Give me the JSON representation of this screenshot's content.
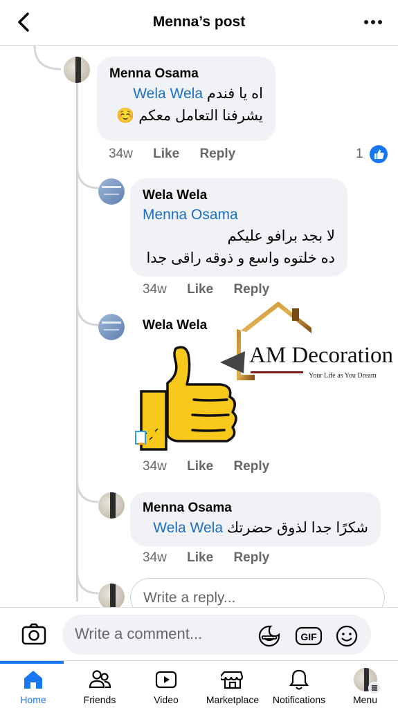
{
  "header": {
    "title": "Menna’s post"
  },
  "comments": [
    {
      "author": "Menna Osama",
      "mention": "Wela Wela",
      "line1": "اه يا فندم",
      "line2": "يشرفنا التعامل معكم",
      "emoji": "☺️",
      "time": "34w",
      "like": "Like",
      "reply": "Reply",
      "reaction_count": "1"
    },
    {
      "author": "Wela Wela",
      "mention": "Menna Osama",
      "line1": "لا بجد برافو عليكم",
      "line2": "ده خلتوه واسع و ذوقه راقى جدا",
      "time": "34w",
      "like": "Like",
      "reply": "Reply"
    },
    {
      "author": "Wela Wela",
      "sticker": "thumbs-up",
      "time": "34w",
      "like": "Like",
      "reply": "Reply"
    },
    {
      "author": "Menna Osama",
      "mention": "Wela Wela",
      "line1": "شكرًا جدا لذوق حضرتك",
      "time": "34w",
      "like": "Like",
      "reply": "Reply"
    }
  ],
  "reply_input": {
    "placeholder": "Write a reply..."
  },
  "composer": {
    "placeholder": "Write a comment..."
  },
  "watermark": {
    "brand": "AM Decoration",
    "tagline": "Your Life as You Dream"
  },
  "tabs": [
    {
      "label": "Home",
      "icon": "home-icon",
      "active": true
    },
    {
      "label": "Friends",
      "icon": "friends-icon"
    },
    {
      "label": "Video",
      "icon": "video-icon"
    },
    {
      "label": "Marketplace",
      "icon": "marketplace-icon"
    },
    {
      "label": "Notifications",
      "icon": "bell-icon"
    },
    {
      "label": "Menu",
      "icon": "menu-avatar"
    }
  ],
  "colors": {
    "accent": "#1877f2",
    "mention": "#1c6fc4",
    "bubble": "#f0f2f5",
    "muted": "#65676b"
  }
}
